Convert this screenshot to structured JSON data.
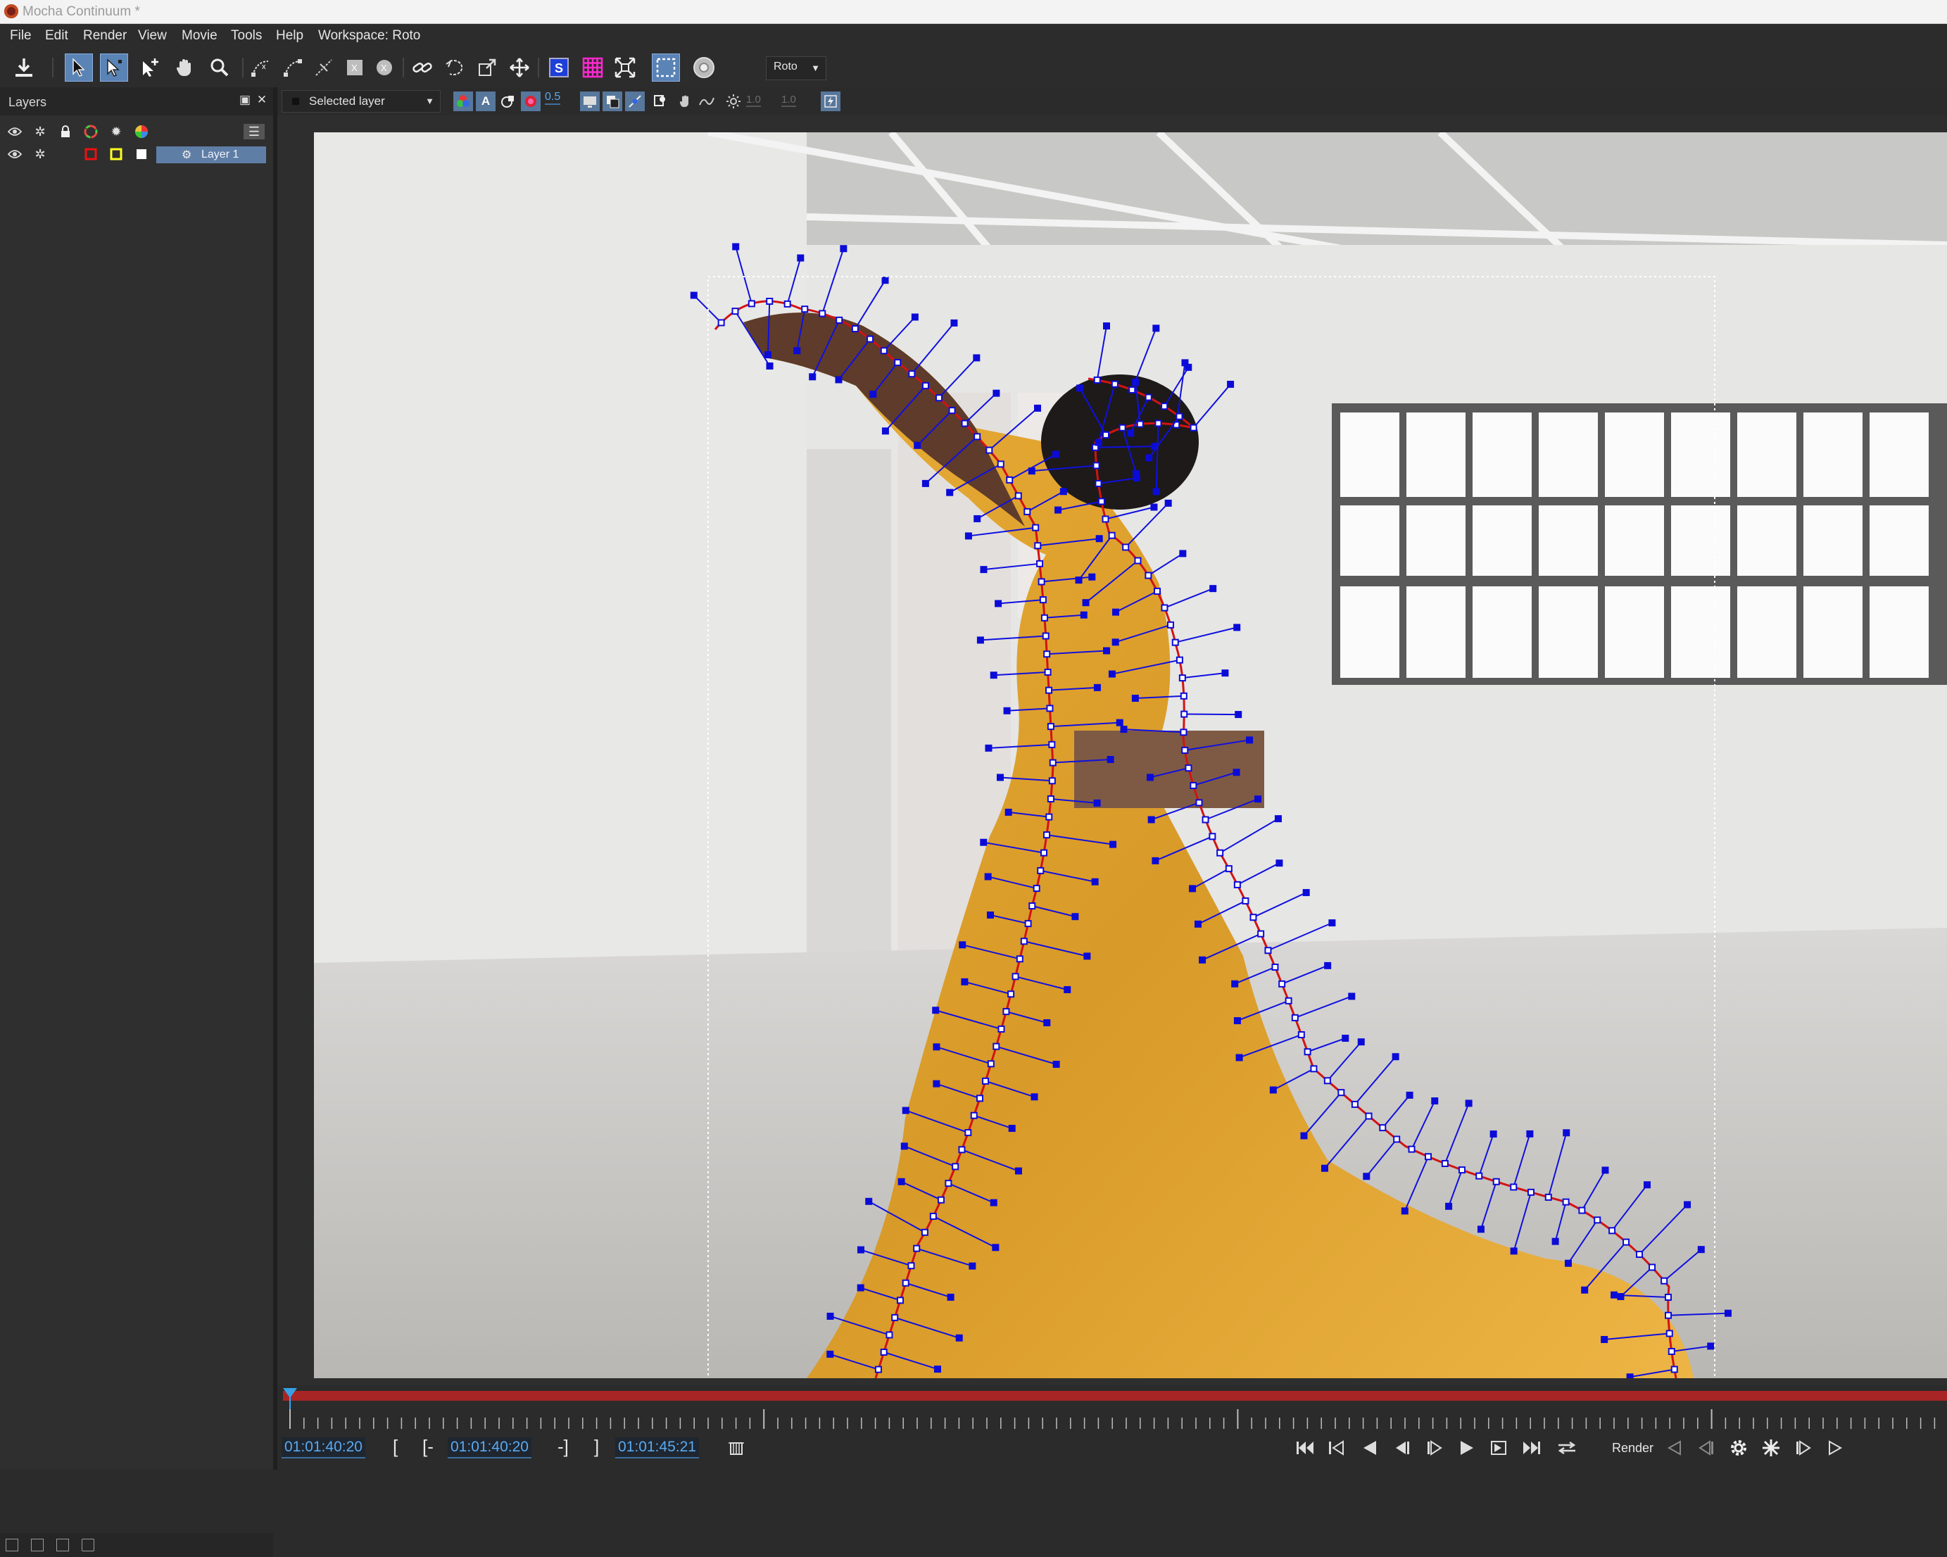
{
  "window": {
    "title": "Mocha Continuum *"
  },
  "menu": [
    "File",
    "Edit",
    "Render",
    "View",
    "Movie",
    "Tools",
    "Help",
    "Workspace: Roto"
  ],
  "toolbar": {
    "workspace_value": "Roto",
    "tools": [
      "save-icon",
      "select-icon",
      "select-points-icon",
      "add-point-icon",
      "hand-icon",
      "zoom-icon",
      "bezier-x-spline-icon",
      "bezier-spline-icon",
      "magnetic-icon",
      "x-spline-icon",
      "circle-x-icon",
      "link-icon",
      "lasso-icon",
      "scale-icon",
      "move-icon",
      "surface-icon",
      "grid-icon",
      "align-icon",
      "roi-icon",
      "stabilize-icon"
    ]
  },
  "layers_panel": {
    "title": "Layers",
    "layers": [
      {
        "name": "Layer 1",
        "color": "#ff0000",
        "fill": "#ffff00"
      }
    ]
  },
  "viewer_toolbar": {
    "layer_select": "Selected layer",
    "opacity_value": "0.5",
    "value_a": "1.0",
    "value_b": "1.0"
  },
  "timeline": {
    "current_time": "01:01:40:20",
    "in_point": "01:01:40:20",
    "out_point": "01:01:45:21",
    "in_bracket": "[",
    "in_set": "[-",
    "out_set": "-]",
    "out_bracket": "]",
    "render_label": "Render"
  },
  "colors": {
    "accent": "#5a83b6",
    "spline": "#0000ff",
    "shape_edge": "#ff0000",
    "range_bar": "#a82525",
    "dress": "#e2a534"
  }
}
